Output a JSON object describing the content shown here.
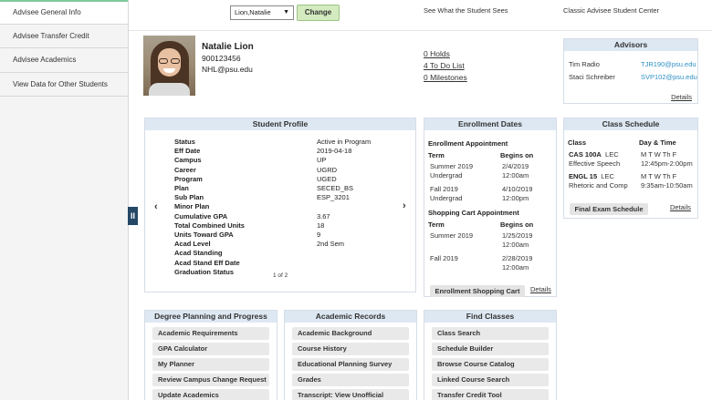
{
  "sidebar": {
    "items": [
      {
        "label": "Advisee General Info"
      },
      {
        "label": "Advisee Transfer Credit"
      },
      {
        "label": "Advisee Academics"
      },
      {
        "label": "View Data for Other Students"
      }
    ],
    "collapse_icon": "pause-bars-icon",
    "collapse_label": "II"
  },
  "topbar": {
    "student_select_value": "Lion,Natalie",
    "change_label": "Change",
    "see_what_student_sees": "See What the Student Sees",
    "classic_center": "Classic Advisee Student Center"
  },
  "student": {
    "name": "Natalie Lion",
    "id": "900123456",
    "email": "NHL@psu.edu",
    "holds": "0 Holds",
    "todo": "4 To Do List",
    "milestones": "0 Milestones"
  },
  "advisors": {
    "title": "Advisors",
    "rows": [
      {
        "name": "Tim Radio",
        "email": "TJR190@psu.edu"
      },
      {
        "name": "Staci Schreiber",
        "email": "SVP102@psu.edu"
      }
    ],
    "details": "Details"
  },
  "profile": {
    "title": "Student Profile",
    "rows": [
      {
        "label": "Status",
        "value": "Active in Program"
      },
      {
        "label": "Eff Date",
        "value": "2019-04-18"
      },
      {
        "label": "Campus",
        "value": "UP"
      },
      {
        "label": "Career",
        "value": "UGRD"
      },
      {
        "label": "Program",
        "value": "UGED"
      },
      {
        "label": "Plan",
        "value": "SECED_BS"
      },
      {
        "label": "Sub Plan",
        "value": "ESP_3201"
      },
      {
        "label": "Minor Plan",
        "value": ""
      },
      {
        "label": "Cumulative GPA",
        "value": "3.67"
      },
      {
        "label": "Total Combined Units",
        "value": "18"
      },
      {
        "label": "Units Toward GPA",
        "value": "9"
      },
      {
        "label": "Acad Level",
        "value": "2nd Sem"
      },
      {
        "label": "Acad Standing",
        "value": ""
      },
      {
        "label": "Acad Stand Eff Date",
        "value": ""
      },
      {
        "label": "Graduation Status",
        "value": ""
      }
    ],
    "prev_arrow": "‹",
    "next_arrow": "›",
    "page": "1 of 2"
  },
  "enrollment": {
    "title": "Enrollment Dates",
    "appointment_heading": "Enrollment Appointment",
    "term_label": "Term",
    "begins_label": "Begins on",
    "appointments": [
      {
        "term": "Summer 2019",
        "sub": "Undergrad",
        "date": "2/4/2019",
        "time": "12:00am"
      },
      {
        "term": "Fall 2019",
        "sub": "Undergrad",
        "date": "4/10/2019",
        "time": "12:00pm"
      }
    ],
    "cart_heading": "Shopping Cart Appointment",
    "cart": [
      {
        "term": "Summer 2019",
        "date": "1/25/2019",
        "time": "12:00am"
      },
      {
        "term": "Fall 2019",
        "date": "2/28/2019",
        "time": "12:00am"
      }
    ],
    "cart_button": "Enrollment Shopping Cart",
    "details": "Details"
  },
  "schedule": {
    "title": "Class Schedule",
    "class_label": "Class",
    "daytime_label": "Day & Time",
    "classes": [
      {
        "code": "CAS 100A",
        "type": "LEC",
        "name": "Effective Speech",
        "days": "M T W Th F",
        "time": "12:45pm-2:00pm"
      },
      {
        "code": "ENGL 15",
        "type": "LEC",
        "name": "Rhetoric and Comp",
        "days": "M T W Th F",
        "time": "9:35am-10:50am"
      }
    ],
    "final_exam": "Final Exam Schedule",
    "details": "Details"
  },
  "bottom": {
    "degree": {
      "title": "Degree Planning and Progress",
      "items": [
        "Academic Requirements",
        "GPA Calculator",
        "My Planner",
        "Review Campus Change Request",
        "Update Academics"
      ]
    },
    "records": {
      "title": "Academic Records",
      "items": [
        "Academic Background",
        "Course History",
        "Educational Planning Survey",
        "Grades",
        "Transcript: View Unofficial"
      ]
    },
    "classes": {
      "title": "Find Classes",
      "items": [
        "Class Search",
        "Schedule Builder",
        "Browse Course Catalog",
        "Linked Course Search",
        "Transfer Credit Tool"
      ]
    }
  }
}
